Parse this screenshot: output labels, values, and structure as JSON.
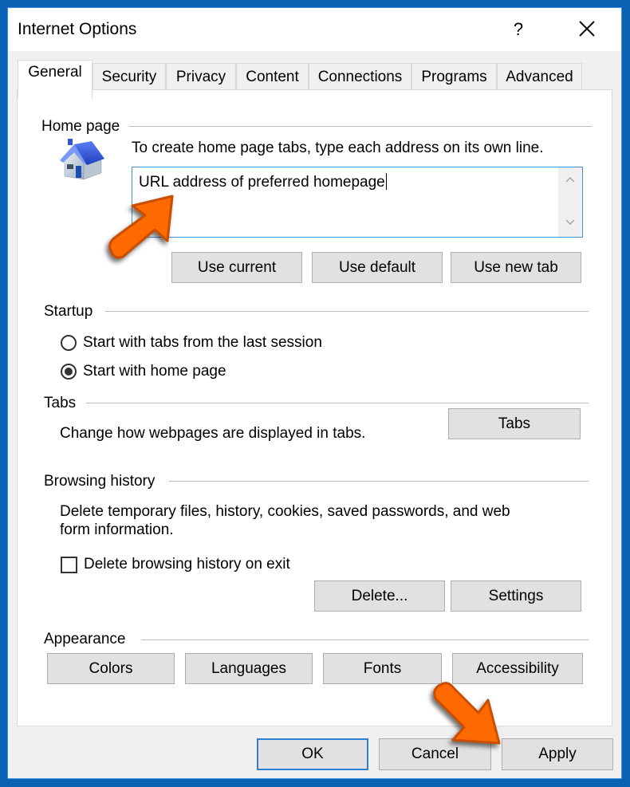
{
  "window": {
    "title": "Internet Options",
    "help_label": "?",
    "close_icon": "close-icon"
  },
  "tabs": [
    {
      "label": "General",
      "active": true
    },
    {
      "label": "Security",
      "active": false
    },
    {
      "label": "Privacy",
      "active": false
    },
    {
      "label": "Content",
      "active": false
    },
    {
      "label": "Connections",
      "active": false
    },
    {
      "label": "Programs",
      "active": false
    },
    {
      "label": "Advanced",
      "active": false
    }
  ],
  "home_page": {
    "label": "Home page",
    "icon": "house-icon",
    "instruction": "To create home page tabs, type each address on its own line.",
    "input_value": "URL address of preferred homepage",
    "buttons": {
      "use_current": "Use current",
      "use_default": "Use default",
      "use_new_tab": "Use new tab"
    }
  },
  "startup": {
    "label": "Startup",
    "options": [
      {
        "label": "Start with tabs from the last session",
        "selected": false
      },
      {
        "label": "Start with home page",
        "selected": true
      }
    ]
  },
  "tabs_section": {
    "label": "Tabs",
    "description": "Change how webpages are displayed in tabs.",
    "button": "Tabs"
  },
  "browsing_history": {
    "label": "Browsing history",
    "description_line1": "Delete temporary files, history, cookies, saved passwords, and web",
    "description_line2": "form information.",
    "checkbox_label": "Delete browsing history on exit",
    "checkbox_checked": false,
    "buttons": {
      "delete": "Delete...",
      "settings": "Settings"
    }
  },
  "appearance": {
    "label": "Appearance",
    "buttons": {
      "colors": "Colors",
      "languages": "Languages",
      "fonts": "Fonts",
      "accessibility": "Accessibility"
    }
  },
  "footer": {
    "ok": "OK",
    "cancel": "Cancel",
    "apply": "Apply"
  },
  "annotations": {
    "arrow_color": "#ff6a00",
    "arrow_outline": "#c94e00"
  }
}
